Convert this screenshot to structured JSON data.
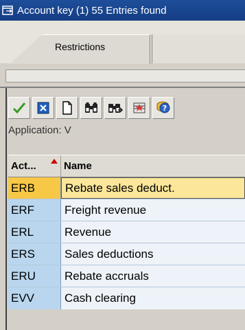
{
  "title": {
    "text": "Account key (1)   55 Entries found"
  },
  "tabs": [
    {
      "label": "Restrictions",
      "active": true
    }
  ],
  "toolbar": {
    "buttons": [
      {
        "icon": "check-icon"
      },
      {
        "icon": "cancel-icon"
      },
      {
        "icon": "new-document-icon"
      },
      {
        "icon": "find-icon"
      },
      {
        "icon": "find-next-icon"
      },
      {
        "icon": "multiple-selection-icon"
      },
      {
        "icon": "help-icon"
      }
    ]
  },
  "application_label": "Application: V",
  "table": {
    "columns": [
      "Act...",
      "Name"
    ],
    "rows": [
      {
        "key": "ERB",
        "name": "Rebate sales deduct.",
        "selected": true
      },
      {
        "key": "ERF",
        "name": "Freight revenue"
      },
      {
        "key": "ERL",
        "name": "Revenue"
      },
      {
        "key": "ERS",
        "name": "Sales deductions"
      },
      {
        "key": "ERU",
        "name": "Rebate accruals"
      },
      {
        "key": "EVV",
        "name": "Cash clearing"
      }
    ]
  },
  "colors": {
    "titlebar": "#1e4e9a",
    "key_column": "#b9d6ee",
    "selected_row": "#fbe69a"
  }
}
